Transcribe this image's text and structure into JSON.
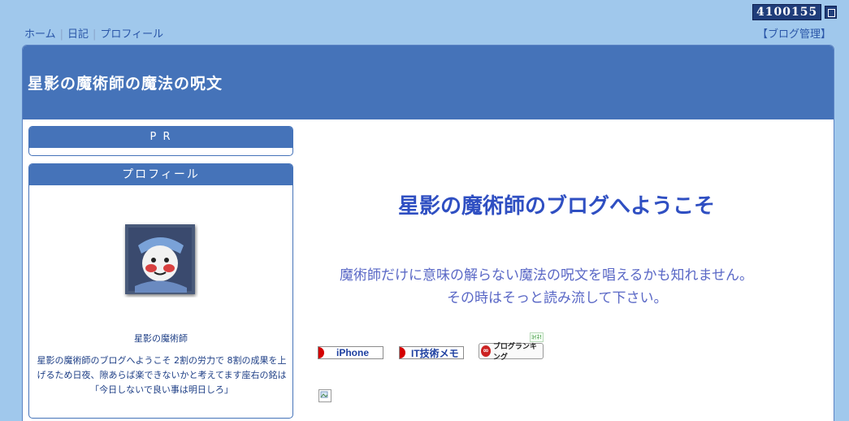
{
  "counter": {
    "value": "4100155",
    "icon": "counter-box-icon"
  },
  "topnav": {
    "items": [
      "ホーム",
      "日記",
      "プロフィール"
    ],
    "separator": "|",
    "admin": "【ブログ管理】"
  },
  "header": {
    "title": "星影の魔術師の魔法の呪文"
  },
  "sidebar": {
    "pr": {
      "title": "P R"
    },
    "profile": {
      "title": "プロフィール",
      "name": "星影の魔術師",
      "description": "星影の魔術師のブログへようこそ 2割の労力で 8割の成果を上げるため日夜、隙あらば楽できないかと考えてます座右の銘は「今日しないで良い事は明日しろ」"
    }
  },
  "main": {
    "welcome": "星影の魔術師のブログへようこそ",
    "message_line1": "魔術師だけに意味の解らない魔法の呪文を唱えるかも知れません。",
    "message_line2": "その時はそっと読み流して下さい。",
    "banners": [
      "iPhone",
      "IT技術メモ"
    ],
    "ranking": {
      "tag": "ﾖｲﾈ!",
      "label": "ブログランキング",
      "icon_glyph": "∞"
    }
  },
  "colors": {
    "page_bg": "#a0c8ec",
    "header_bg": "#4573b9",
    "link": "#2a56a8",
    "welcome": "#2f4fc2"
  }
}
